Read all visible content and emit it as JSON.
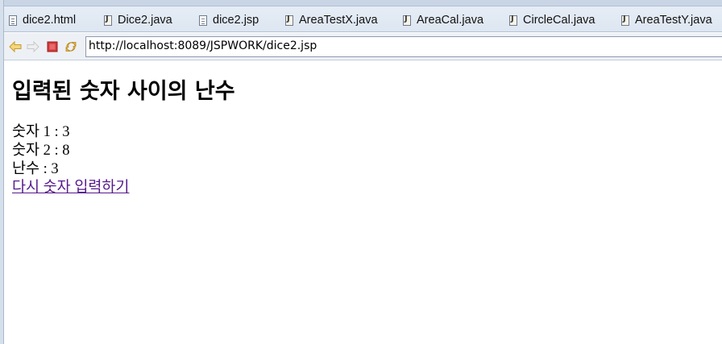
{
  "tabs": [
    {
      "label": "dice2.html",
      "icon": "html-file-icon"
    },
    {
      "label": "Dice2.java",
      "icon": "java-file-icon"
    },
    {
      "label": "dice2.jsp",
      "icon": "jsp-file-icon"
    },
    {
      "label": "AreaTestX.java",
      "icon": "java-file-icon"
    },
    {
      "label": "AreaCal.java",
      "icon": "java-file-icon"
    },
    {
      "label": "CircleCal.java",
      "icon": "java-file-icon"
    },
    {
      "label": "AreaTestY.java",
      "icon": "java-file-icon"
    }
  ],
  "toolbar": {
    "back_icon": "back-arrow-icon",
    "forward_icon": "forward-arrow-icon",
    "stop_icon": "stop-icon",
    "refresh_icon": "refresh-icon",
    "url": "http://localhost:8089/JSPWORK/dice2.jsp"
  },
  "page": {
    "heading": "입력된 숫자 사이의 난수",
    "number1": "숫자 1 : 3",
    "number2": "숫자 2 : 8",
    "random": "난수 : 3",
    "link_text": "다시 숫자 입력하기"
  },
  "colors": {
    "link_visited": "#551a8b",
    "stop_red": "#cc2a2a",
    "arrow_yellow": "#e8b93a",
    "tabbar_bg": "#dde6f1"
  }
}
